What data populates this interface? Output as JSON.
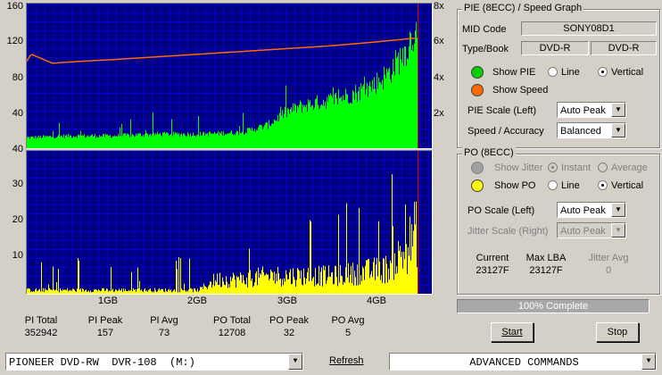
{
  "colors": {
    "pie_fill": "#00ff00",
    "po_fill": "#ffff00",
    "speed_line": "#ff6a00",
    "grid": "#0000cc",
    "plot_bg": "#000080",
    "end_marker": "#cc0000"
  },
  "upper_chart": {
    "left_ticks": [
      "160",
      "120",
      "80",
      "40"
    ],
    "right_ticks": [
      "8x",
      "6x",
      "4x",
      "2x"
    ]
  },
  "lower_chart": {
    "left_ticks": [
      "40",
      "30",
      "20",
      "10"
    ]
  },
  "x_ticks": [
    "1GB",
    "2GB",
    "3GB",
    "4GB"
  ],
  "chart_data": [
    {
      "type": "area",
      "ylim": [
        0,
        160
      ],
      "y2lim": [
        0,
        8
      ],
      "xlim": [
        0,
        4.55
      ],
      "x_unit": "GB",
      "series": [
        {
          "values_x": [
            0,
            0.5,
            1.0,
            1.5,
            2.0,
            2.5,
            2.8,
            3.0,
            3.2,
            3.4,
            3.6,
            3.8,
            4.0,
            4.2,
            4.4,
            4.55
          ],
          "values_y": [
            12,
            14,
            14,
            16,
            16,
            18,
            26,
            40,
            48,
            52,
            56,
            62,
            70,
            84,
            110,
            140
          ]
        },
        {
          "values_x": [
            0,
            0.05,
            0.3,
            0.6,
            1.0,
            1.5,
            2.0,
            2.5,
            3.0,
            3.5,
            4.0,
            4.55
          ],
          "values_y": [
            4.8,
            5.2,
            4.7,
            4.8,
            4.9,
            5.05,
            5.2,
            5.35,
            5.5,
            5.65,
            5.85,
            6.1
          ]
        }
      ]
    },
    {
      "type": "bar",
      "ylim": [
        0,
        40
      ],
      "xlim": [
        0,
        4.55
      ],
      "x_unit": "GB",
      "series": [
        {
          "values_x": [
            0,
            0.5,
            1.0,
            1.5,
            2.0,
            2.2,
            2.5,
            2.8,
            3.0,
            3.3,
            3.6,
            3.9,
            4.2,
            4.4,
            4.55
          ],
          "values_y": [
            1,
            1,
            1,
            1,
            1,
            4,
            4,
            5,
            5,
            5,
            5,
            6,
            7,
            12,
            18
          ]
        }
      ]
    }
  ],
  "pie_group": {
    "title": "PIE (8ECC) / Speed Graph",
    "mid_code_label": "MID Code",
    "mid_code_value": "SONY08D1",
    "type_book_label": "Type/Book",
    "type_value": "DVD-R",
    "book_value": "DVD-R",
    "show_pie_label": "Show PIE",
    "show_speed_label": "Show Speed",
    "line_label": "Line",
    "vertical_label": "Vertical",
    "pie_scale_label": "PIE Scale (Left)",
    "pie_scale_value": "Auto Peak",
    "speed_acc_label": "Speed / Accuracy",
    "speed_acc_value": "Balanced"
  },
  "po_group": {
    "title": "PO (8ECC)",
    "show_jitter_label": "Show Jitter",
    "instant_label": "Instant",
    "average_label": "Average",
    "show_po_label": "Show PO",
    "line_label": "Line",
    "vertical_label": "Vertical",
    "po_scale_label": "PO Scale (Left)",
    "po_scale_value": "Auto Peak",
    "jitter_scale_label": "Jitter Scale (Right)",
    "jitter_scale_value": "Auto Peak",
    "current_label": "Current",
    "current_value": "23127F",
    "max_lba_label": "Max LBA",
    "max_lba_value": "23127F",
    "jitter_avg_label": "Jitter Avg",
    "jitter_avg_value": "0"
  },
  "progress": {
    "text": "100% Complete",
    "fraction": 1.0
  },
  "buttons": {
    "start": "Start",
    "stop": "Stop",
    "refresh": "Refresh"
  },
  "stats": [
    {
      "label": "PI Total",
      "value": "352942"
    },
    {
      "label": "PI Peak",
      "value": "157"
    },
    {
      "label": "PI Avg",
      "value": "73"
    },
    {
      "label": "PO Total",
      "value": "12708"
    },
    {
      "label": "PO Peak",
      "value": "32"
    },
    {
      "label": "PO Avg",
      "value": "5"
    }
  ],
  "drive_select": "PIONEER DVD-RW  DVR-108  (M:)",
  "advanced_select": "ADVANCED COMMANDS"
}
